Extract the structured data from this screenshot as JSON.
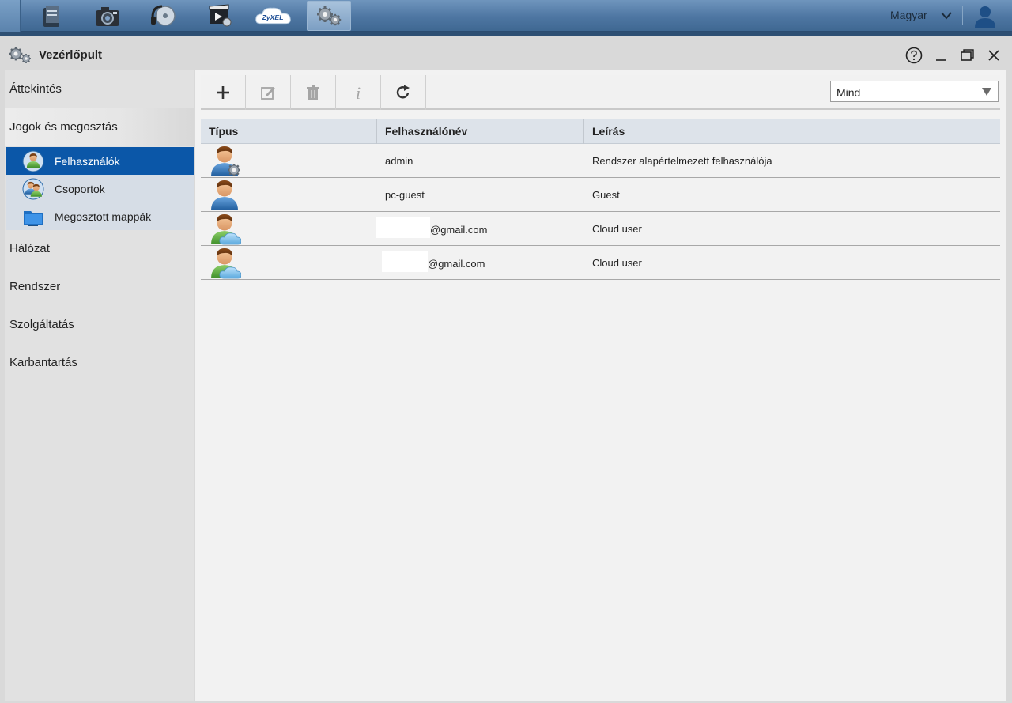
{
  "topbar": {
    "apps": [
      {
        "name": "file-browser-app-icon"
      },
      {
        "name": "photo-app-icon"
      },
      {
        "name": "music-app-icon"
      },
      {
        "name": "video-app-icon"
      },
      {
        "name": "zyxel-cloud-app-icon",
        "label": "ZyXEL"
      },
      {
        "name": "control-panel-app-icon"
      }
    ],
    "language": "Magyar"
  },
  "window": {
    "title": "Vezérlőpult"
  },
  "sidebar": {
    "items": [
      {
        "label": "Áttekintés"
      },
      {
        "label": "Jogok és megosztás"
      },
      {
        "label": "Hálózat"
      },
      {
        "label": "Rendszer"
      },
      {
        "label": "Szolgáltatás"
      },
      {
        "label": "Karbantartás"
      }
    ],
    "subitems": [
      {
        "label": "Felhasználók",
        "active": true
      },
      {
        "label": "Csoportok"
      },
      {
        "label": "Megosztott mappák"
      }
    ]
  },
  "filter": {
    "selected": "Mind"
  },
  "table": {
    "columns": [
      "Típus",
      "Felhasználónév",
      "Leírás"
    ],
    "rows": [
      {
        "type": "admin-user-icon",
        "username": "admin",
        "description": "Rendszer alapértelmezett felhasználója"
      },
      {
        "type": "user-icon",
        "username": "pc-guest",
        "description": "Guest"
      },
      {
        "type": "cloud-user-icon",
        "username": "@gmail.com",
        "description": "Cloud user"
      },
      {
        "type": "cloud-user-icon",
        "username": "@gmail.com",
        "description": "Cloud user"
      }
    ]
  },
  "colors": {
    "topbar": "#4e76a2",
    "active_nav": "#0b57a8",
    "header_bg": "#dde3ea"
  }
}
